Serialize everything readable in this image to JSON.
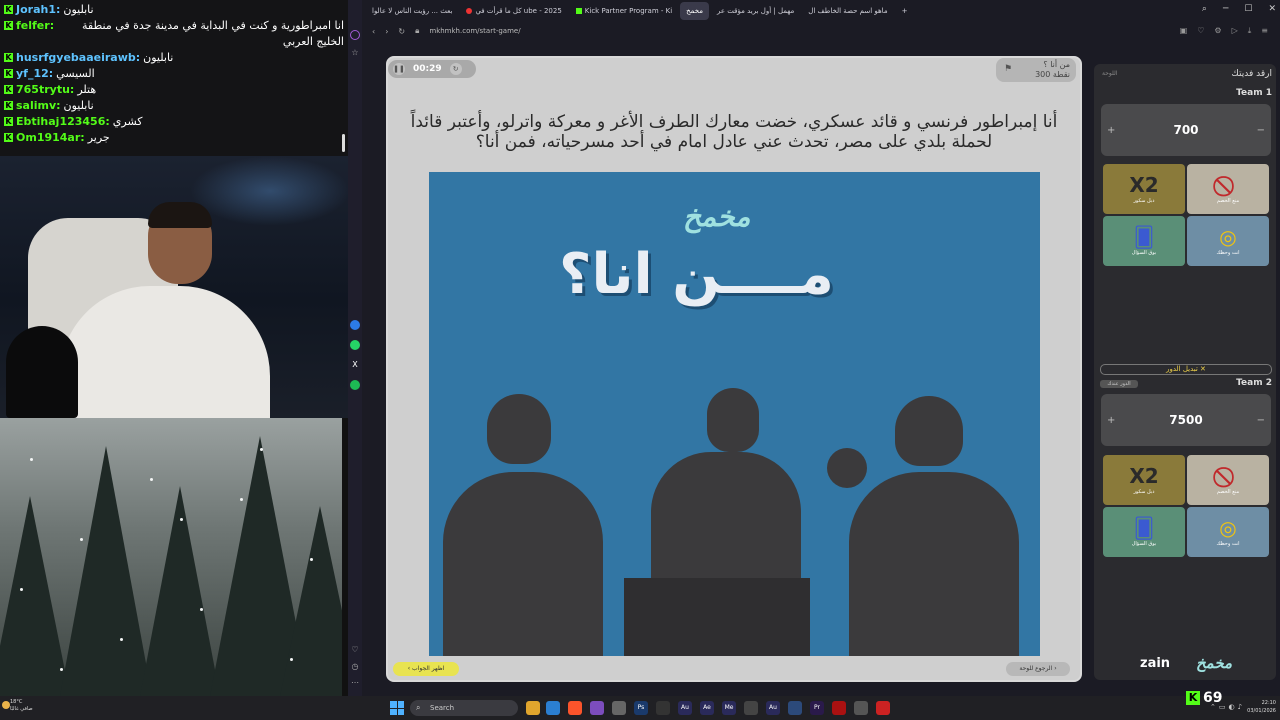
{
  "chat": {
    "lines": [
      {
        "user": "Jorah1:",
        "msg": "نابليون",
        "blue": true
      },
      {
        "user": "felfer:",
        "msg": "انا امبراطورية و كنت في البداية في مدينة جدة في منطقة الخليج العربي",
        "blue": false
      },
      {
        "user": "husrfgyebaaeirawb:",
        "msg": "نابليون",
        "blue": true
      },
      {
        "user": "yf_12:",
        "msg": "السيسي",
        "blue": true
      },
      {
        "user": "765trytu:",
        "msg": "هتلر",
        "blue": false
      },
      {
        "user": "salimv:",
        "msg": "نابليون",
        "blue": false
      },
      {
        "user": "Ebtihaj123456:",
        "msg": "كشري",
        "blue": false
      },
      {
        "user": "Om1914ar:",
        "msg": "جرير",
        "blue": false
      }
    ]
  },
  "browser": {
    "tabs": [
      {
        "label": "بعث ... رؤيت الناس لا عالوا",
        "type": "plain"
      },
      {
        "label": "كل ما قرأت في ube - 2025",
        "type": "yt"
      },
      {
        "label": "Kick Partner Program - Ki",
        "type": "kick"
      },
      {
        "label": "مخمخ",
        "type": "active"
      },
      {
        "label": "مهمل | أول بريد مؤقت عر",
        "type": "plain"
      },
      {
        "label": "ماهو اسم حصة الخاطف ال",
        "type": "plain"
      }
    ],
    "url": "mkhmkh.com/start-game/",
    "win_min": "─",
    "win_max": "☐",
    "win_close": "✕"
  },
  "game": {
    "timer": "00:29",
    "question_label": "من أنا ؟",
    "points": "300 نقطة",
    "question": "أنا إمبراطور فرنسي و قائد عسكري، خضت معارك الطرف الأغر و معركة واترلو، وأعتبر قائداً لحملة بلدي على مصر، تحدث عني عادل امام في أحد مسرحياته، فمن أنا؟",
    "image_logo": "مخمخ",
    "image_title": "مــــن انا؟",
    "show_answer": "اظهر الجواب",
    "back_to_board": "الرجوع للوحة"
  },
  "board": {
    "title": "ارقد فديتك",
    "subtitle": "اللوحة",
    "team1": {
      "name": "Team 1",
      "score": "700"
    },
    "team2": {
      "name": "Team 2",
      "score": "7500"
    },
    "plus": "+",
    "minus": "−",
    "swap_turn": "تبديل الدور ✕",
    "turn_badge": "الدور عندك",
    "tools": [
      {
        "icon": "X2",
        "label": "دبل سكور"
      },
      {
        "icon": "⃠",
        "label": "منع الخصم"
      },
      {
        "icon": "🂠",
        "label": "بوق السؤال"
      },
      {
        "icon": "◎",
        "label": "انت وحظك"
      }
    ],
    "brand_zain": "zain",
    "brand_logo": "مخمخ"
  },
  "taskbar": {
    "weather_temp": "18°C",
    "weather_desc": "صافي غالبًا",
    "search": "Search",
    "kick_count": "69",
    "time": "22:10",
    "date": "03/01/2026"
  },
  "colors": {
    "kick_green": "#53fc18",
    "card_bg": "#cfcfcf",
    "image_bg": "#3276a4",
    "answer_btn": "#e8e351"
  }
}
